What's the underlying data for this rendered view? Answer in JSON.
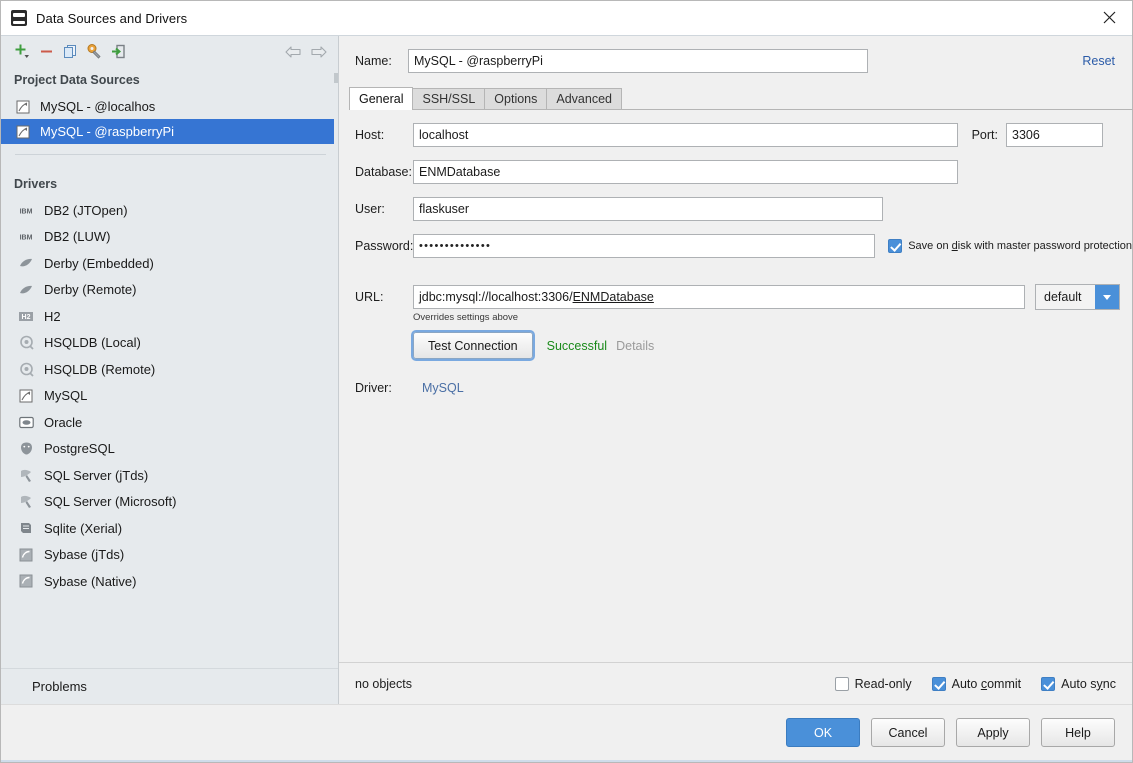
{
  "window": {
    "title": "Data Sources and Drivers",
    "app_icon": "pycharm-icon",
    "close_icon": "close-icon"
  },
  "sidebar": {
    "toolbar": [
      {
        "name": "add-data-source-button",
        "icon": "plus-icon"
      },
      {
        "name": "remove-data-source-button",
        "icon": "minus-icon"
      },
      {
        "name": "copy-data-source-button",
        "icon": "copy-icon"
      },
      {
        "name": "properties-button",
        "icon": "wrench-icon"
      },
      {
        "name": "import-button",
        "icon": "import-icon"
      },
      {
        "name": "nav-back-button",
        "icon": "arrow-left-icon"
      },
      {
        "name": "nav-forward-button",
        "icon": "arrow-right-icon"
      }
    ],
    "project_group_label": "Project Data Sources",
    "data_sources": [
      {
        "label": "MySQL - @localhos",
        "icon": "mysql-icon",
        "selected": false
      },
      {
        "label": "MySQL - @raspberryPi",
        "icon": "mysql-icon",
        "selected": true
      }
    ],
    "drivers_group_label": "Drivers",
    "drivers": [
      {
        "label": "DB2 (JTOpen)",
        "icon": "ibm-icon"
      },
      {
        "label": "DB2 (LUW)",
        "icon": "ibm-icon"
      },
      {
        "label": "Derby (Embedded)",
        "icon": "derby-icon"
      },
      {
        "label": "Derby (Remote)",
        "icon": "derby-icon"
      },
      {
        "label": "H2",
        "icon": "h2-icon"
      },
      {
        "label": "HSQLDB (Local)",
        "icon": "hsqldb-icon"
      },
      {
        "label": "HSQLDB (Remote)",
        "icon": "hsqldb-icon"
      },
      {
        "label": "MySQL",
        "icon": "mysql-icon"
      },
      {
        "label": "Oracle",
        "icon": "oracle-icon"
      },
      {
        "label": "PostgreSQL",
        "icon": "postgresql-icon"
      },
      {
        "label": "SQL Server (jTds)",
        "icon": "sqlserver-icon"
      },
      {
        "label": "SQL Server (Microsoft)",
        "icon": "sqlserver-icon"
      },
      {
        "label": "Sqlite (Xerial)",
        "icon": "sqlite-icon"
      },
      {
        "label": "Sybase (jTds)",
        "icon": "sybase-icon"
      },
      {
        "label": "Sybase (Native)",
        "icon": "sybase-icon"
      }
    ],
    "problems_label": "Problems"
  },
  "details": {
    "name_label": "Name:",
    "name_value": "MySQL - @raspberryPi",
    "reset_label": "Reset",
    "tabs": [
      {
        "label": "General",
        "active": true
      },
      {
        "label": "SSH/SSL",
        "active": false
      },
      {
        "label": "Options",
        "active": false
      },
      {
        "label": "Advanced",
        "active": false
      }
    ],
    "host_label": "Host:",
    "host_value": "localhost",
    "port_label": "Port:",
    "port_value": "3306",
    "database_label": "Database:",
    "database_value": "ENMDatabase",
    "user_label": "User:",
    "user_value": "flaskuser",
    "password_label": "Password:",
    "password_value": "••••••••••••••",
    "save_on_disk": {
      "label_pre": "Save on ",
      "label_mnemonic": "d",
      "label_post": "isk with master password protection",
      "checked": true
    },
    "url_label": "URL:",
    "url_prefix": "jdbc:mysql://localhost:3306/",
    "url_database": "ENMDatabase",
    "url_dropdown_value": "default",
    "url_hint": "Overrides settings above",
    "test_connection_label": "Test Connection",
    "test_status": "Successful",
    "test_details_label": "Details",
    "driver_label": "Driver:",
    "driver_value": "MySQL"
  },
  "bottom": {
    "objects_status": "no objects",
    "readonly": {
      "label": "Read-only",
      "checked": false
    },
    "auto_commit": {
      "label_pre": "Auto ",
      "label_mnemonic": "c",
      "label_post": "ommit",
      "checked": true
    },
    "auto_sync": {
      "label_pre": "Auto s",
      "label_mnemonic": "y",
      "label_post": "nc",
      "checked": true
    }
  },
  "footer": {
    "ok": "OK",
    "cancel": "Cancel",
    "apply": "Apply",
    "help": "Help"
  },
  "colors": {
    "accent_blue": "#4a90d9",
    "selection_blue": "#3675d3",
    "success_green": "#1a8a1a",
    "link_blue": "#2b5ba8",
    "sidebar_bg": "#e6eaed"
  }
}
